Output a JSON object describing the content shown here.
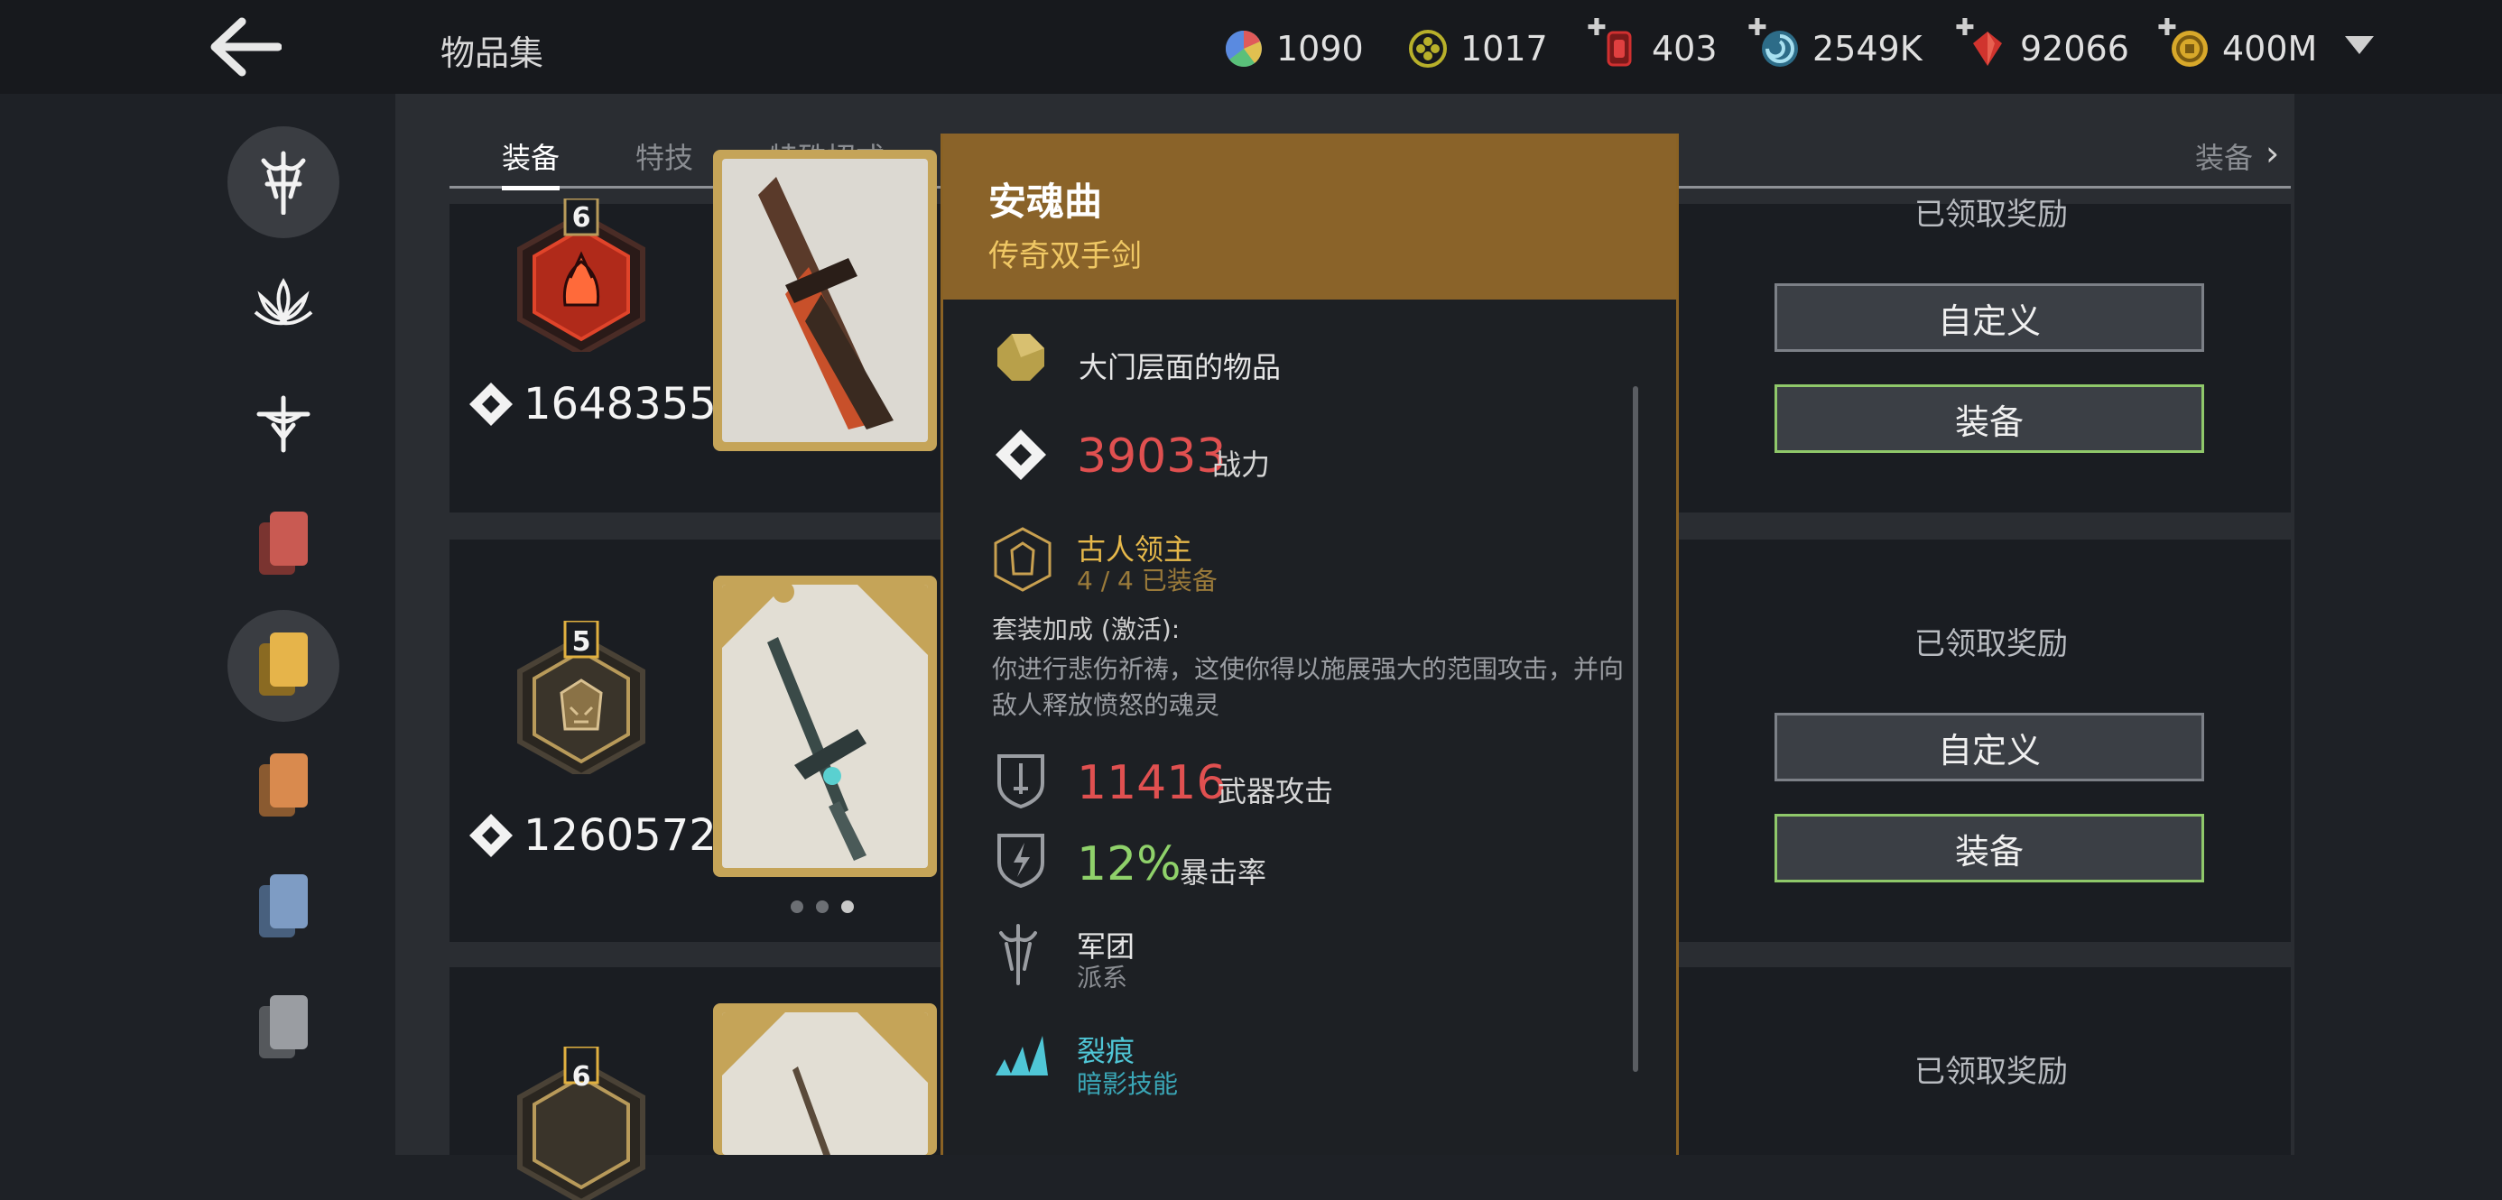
{
  "header": {
    "title": "物品集",
    "resources": [
      {
        "name": "pie-currency",
        "value": "1090",
        "has_plus": false
      },
      {
        "name": "clover-currency",
        "value": "1017",
        "has_plus": false
      },
      {
        "name": "red-gem-currency",
        "value": "403",
        "has_plus": true
      },
      {
        "name": "swirl-currency",
        "value": "2549K",
        "has_plus": true
      },
      {
        "name": "ruby-currency",
        "value": "92066",
        "has_plus": true
      },
      {
        "name": "coin-currency",
        "value": "400M",
        "has_plus": true
      }
    ]
  },
  "tabs": {
    "items": [
      "装备",
      "特技",
      "特殊招式"
    ],
    "active": "装备",
    "right_label": "装备"
  },
  "rows": [
    {
      "level": "6",
      "power": "1648355",
      "claimed": "已领取奖励",
      "customize": "自定义",
      "equip": "装备",
      "badge_color": "#e0442a"
    },
    {
      "level": "5",
      "power": "1260572",
      "claimed": "已领取奖励",
      "customize": "自定义",
      "equip": "装备",
      "badge_color": "#b89a5a"
    },
    {
      "level": "6",
      "power": "",
      "claimed": "已领取奖励",
      "customize": "",
      "equip": "",
      "badge_color": "#b89a5a"
    }
  ],
  "popup": {
    "name": "安魂曲",
    "type": "传奇双手剑",
    "tier": "大门层面的物品",
    "power_value": "39033",
    "power_label": "战力",
    "set_name": "古人领主",
    "set_progress": "4 / 4 已装备",
    "set_bonus_title": "套装加成 (激活):",
    "set_bonus_desc": "你进行悲伤祈祷，这使你得以施展强大的范围攻击，并向敌人释放愤怒的魂灵",
    "attack_value": "11416",
    "attack_label": "武器攻击",
    "crit_value": "12%",
    "crit_label": "暴击率",
    "faction_name": "军团",
    "faction_label": "派系",
    "skill_name": "裂痕",
    "skill_label": "暗影技能"
  },
  "colors": {
    "accent_gold": "#8a6329",
    "power_red": "#e05050",
    "crit_green": "#8fd16a",
    "skill_cyan": "#4fc6d6",
    "set_gold": "#e6b84a"
  }
}
